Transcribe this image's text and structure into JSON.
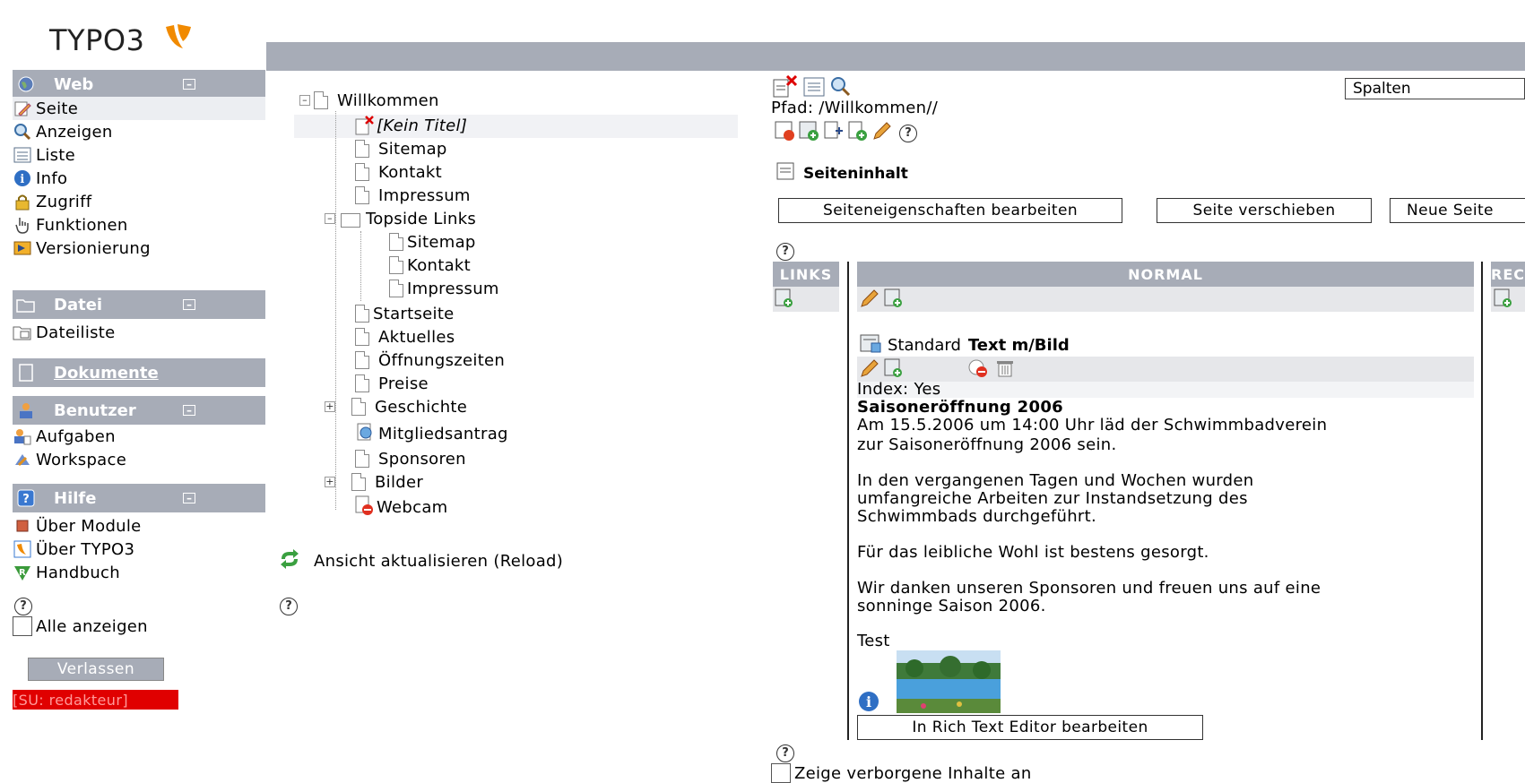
{
  "logo": {
    "text": "TYPO3"
  },
  "left_menu": {
    "groups": [
      {
        "label": "Web"
      },
      {
        "label": "Datei"
      },
      {
        "label": "Dokumente"
      },
      {
        "label": "Benutzer"
      },
      {
        "label": "Hilfe"
      }
    ],
    "web_items": [
      "Seite",
      "Anzeigen",
      "Liste",
      "Info",
      "Zugriff",
      "Funktionen",
      "Versionierung"
    ],
    "datei_items": [
      "Dateiliste"
    ],
    "benutzer_items": [
      "Aufgaben",
      "Workspace"
    ],
    "hilfe_items": [
      "Über Module",
      "Über TYPO3",
      "Handbuch"
    ],
    "help_symbol": "?",
    "show_all_label": "Alle anzeigen",
    "logout_label": "Verlassen",
    "su_badge": "[SU: redakteur]"
  },
  "page_tree": {
    "root": "Willkommen",
    "items": [
      "[Kein Titel]",
      "Sitemap",
      "Kontakt",
      "Impressum",
      "Topside Links",
      "Sitemap",
      "Kontakt",
      "Impressum",
      "Startseite",
      "Aktuelles",
      "Öffnungszeiten",
      "Preise",
      "Geschichte",
      "Mitgliedsantrag",
      "Sponsoren",
      "Bilder",
      "Webcam"
    ],
    "reload_label": "Ansicht aktualisieren (Reload)",
    "help_symbol": "?"
  },
  "content": {
    "path": "Pfad: /Willkommen//",
    "view_select": "Spalten",
    "section_title": "Seiteninhalt",
    "buttons": {
      "edit_props": "Seiteneigenschaften bearbeiten",
      "move_page": "Seite verschieben",
      "new_page": "Neue Seite"
    },
    "columns": {
      "left": "LINKS",
      "normal": "NORMAL",
      "right": "REC"
    },
    "element": {
      "type_prefix": "Standard",
      "type_bold": "Text m/Bild",
      "index": "Index: Yes",
      "headline": "Saisoneröffnung 2006",
      "paragraphs": [
        "Am 15.5.2006 um 14:00 Uhr läd der Schwimmbadverein",
        "zur Saisoneröffnung 2006 sein.",
        "In den vergangenen Tagen und Wochen wurden",
        "umfangreiche Arbeiten zur Instandsetzung des",
        "Schwimmbads durchgeführt.",
        "Für das leibliche Wohl ist bestens gesorgt.",
        "Wir danken unseren Sponsoren und freuen uns auf eine",
        "sonninge Saison 2006.",
        "Test"
      ],
      "rte_button": "In Rich Text Editor bearbeiten"
    },
    "help_symbol": "?",
    "show_hidden_label": "Zeige verborgene Inhalte an"
  },
  "colors": {
    "menu_gray": "#a7acb7",
    "badge_red": "#e00000",
    "logo_orange": "#f18a00"
  }
}
